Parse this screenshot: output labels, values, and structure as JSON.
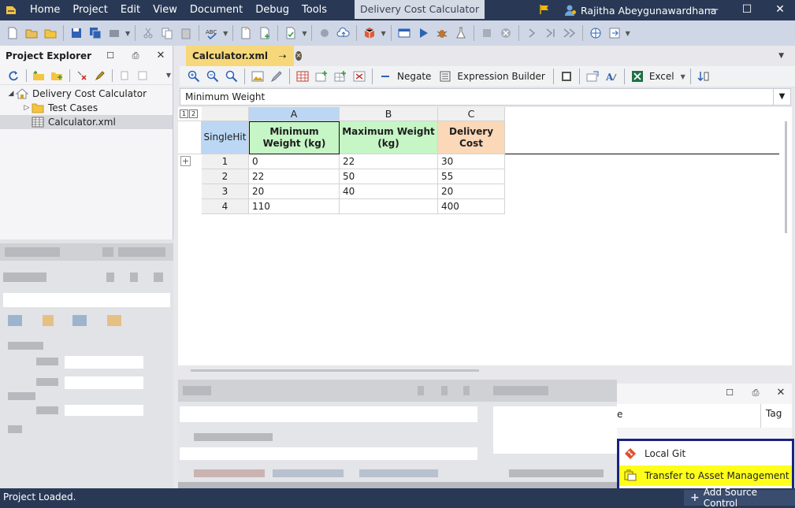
{
  "menubar": {
    "items": [
      "Home",
      "Project",
      "Edit",
      "View",
      "Document",
      "Debug",
      "Tools"
    ],
    "window_title": "Delivery Cost Calculator",
    "user_name": "Rajitha Abeygunawardhana"
  },
  "project_explorer": {
    "title": "Project Explorer",
    "tree": [
      {
        "label": "Delivery Cost Calculator",
        "icon": "project-icon"
      },
      {
        "label": "Test Cases",
        "icon": "folder-icon"
      },
      {
        "label": "Calculator.xml",
        "icon": "table-file-icon"
      }
    ]
  },
  "document": {
    "tab_label": "Calculator.xml"
  },
  "editor_toolbar": {
    "negate_label": "Negate",
    "expression_builder_label": "Expression Builder",
    "excel_label": "Excel"
  },
  "formula_bar": {
    "value": "Minimum Weight"
  },
  "grid": {
    "level_buttons": [
      "1",
      "2"
    ],
    "hit_policy": "SingleHit",
    "column_letters": [
      "A",
      "B",
      "C"
    ],
    "column_headers": [
      "Minimum Weight (kg)",
      "Maximum Weight (kg)",
      "Delivery Cost"
    ],
    "column_colors": [
      "#c6f5c6",
      "#c6f5c6",
      "#fbd8b8"
    ],
    "rows": [
      {
        "num": "1",
        "cells": [
          "0",
          "22",
          "30"
        ]
      },
      {
        "num": "2",
        "cells": [
          "22",
          "50",
          "55"
        ]
      },
      {
        "num": "3",
        "cells": [
          "20",
          "40",
          "20"
        ]
      },
      {
        "num": "4",
        "cells": [
          "110",
          "",
          "400"
        ]
      }
    ]
  },
  "bottom_panel": {
    "column_fragment": "e",
    "tag_column": "Tag"
  },
  "source_popup": {
    "items": [
      {
        "label": "Local Git",
        "icon": "git-icon"
      },
      {
        "label": "Transfer to Asset Management",
        "icon": "transfer-icon"
      }
    ]
  },
  "statusbar": {
    "status_text": "Project Loaded.",
    "add_source_control_label": "Add Source Control"
  }
}
